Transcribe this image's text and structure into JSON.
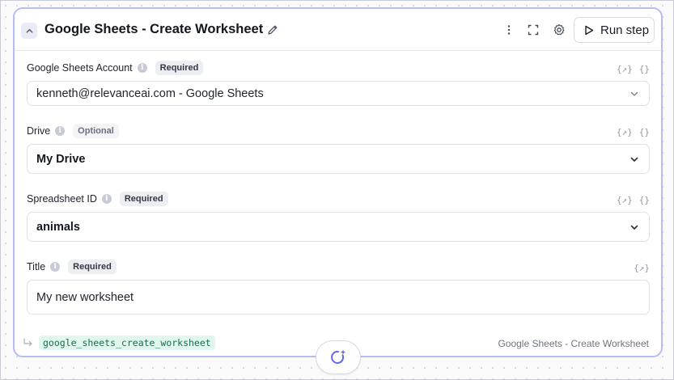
{
  "header": {
    "title": "Google Sheets - Create Worksheet",
    "run_label": "Run step"
  },
  "fields": [
    {
      "label": "Google Sheets Account",
      "badge": "Required",
      "value": "kenneth@relevanceai.com - Google Sheets",
      "var_icons": [
        "{↗}",
        "{}"
      ]
    },
    {
      "label": "Drive",
      "badge": "Optional",
      "value": "My Drive",
      "var_icons": [
        "{↗}",
        "{}"
      ]
    },
    {
      "label": "Spreadsheet ID",
      "badge": "Required",
      "value": "animals",
      "var_icons": [
        "{↗}",
        "{}"
      ]
    },
    {
      "label": "Title",
      "badge": "Required",
      "value": "My new worksheet",
      "var_icons": [
        "{↗}"
      ]
    }
  ],
  "footer": {
    "tool_id": "google_sheets_create_worksheet",
    "tool_name": "Google Sheets - Create Worksheet"
  },
  "colors": {
    "card_border": "#b6bcf6",
    "accent": "#6366f1",
    "code_bg": "#e1f7ee",
    "code_text": "#1a6a52"
  }
}
